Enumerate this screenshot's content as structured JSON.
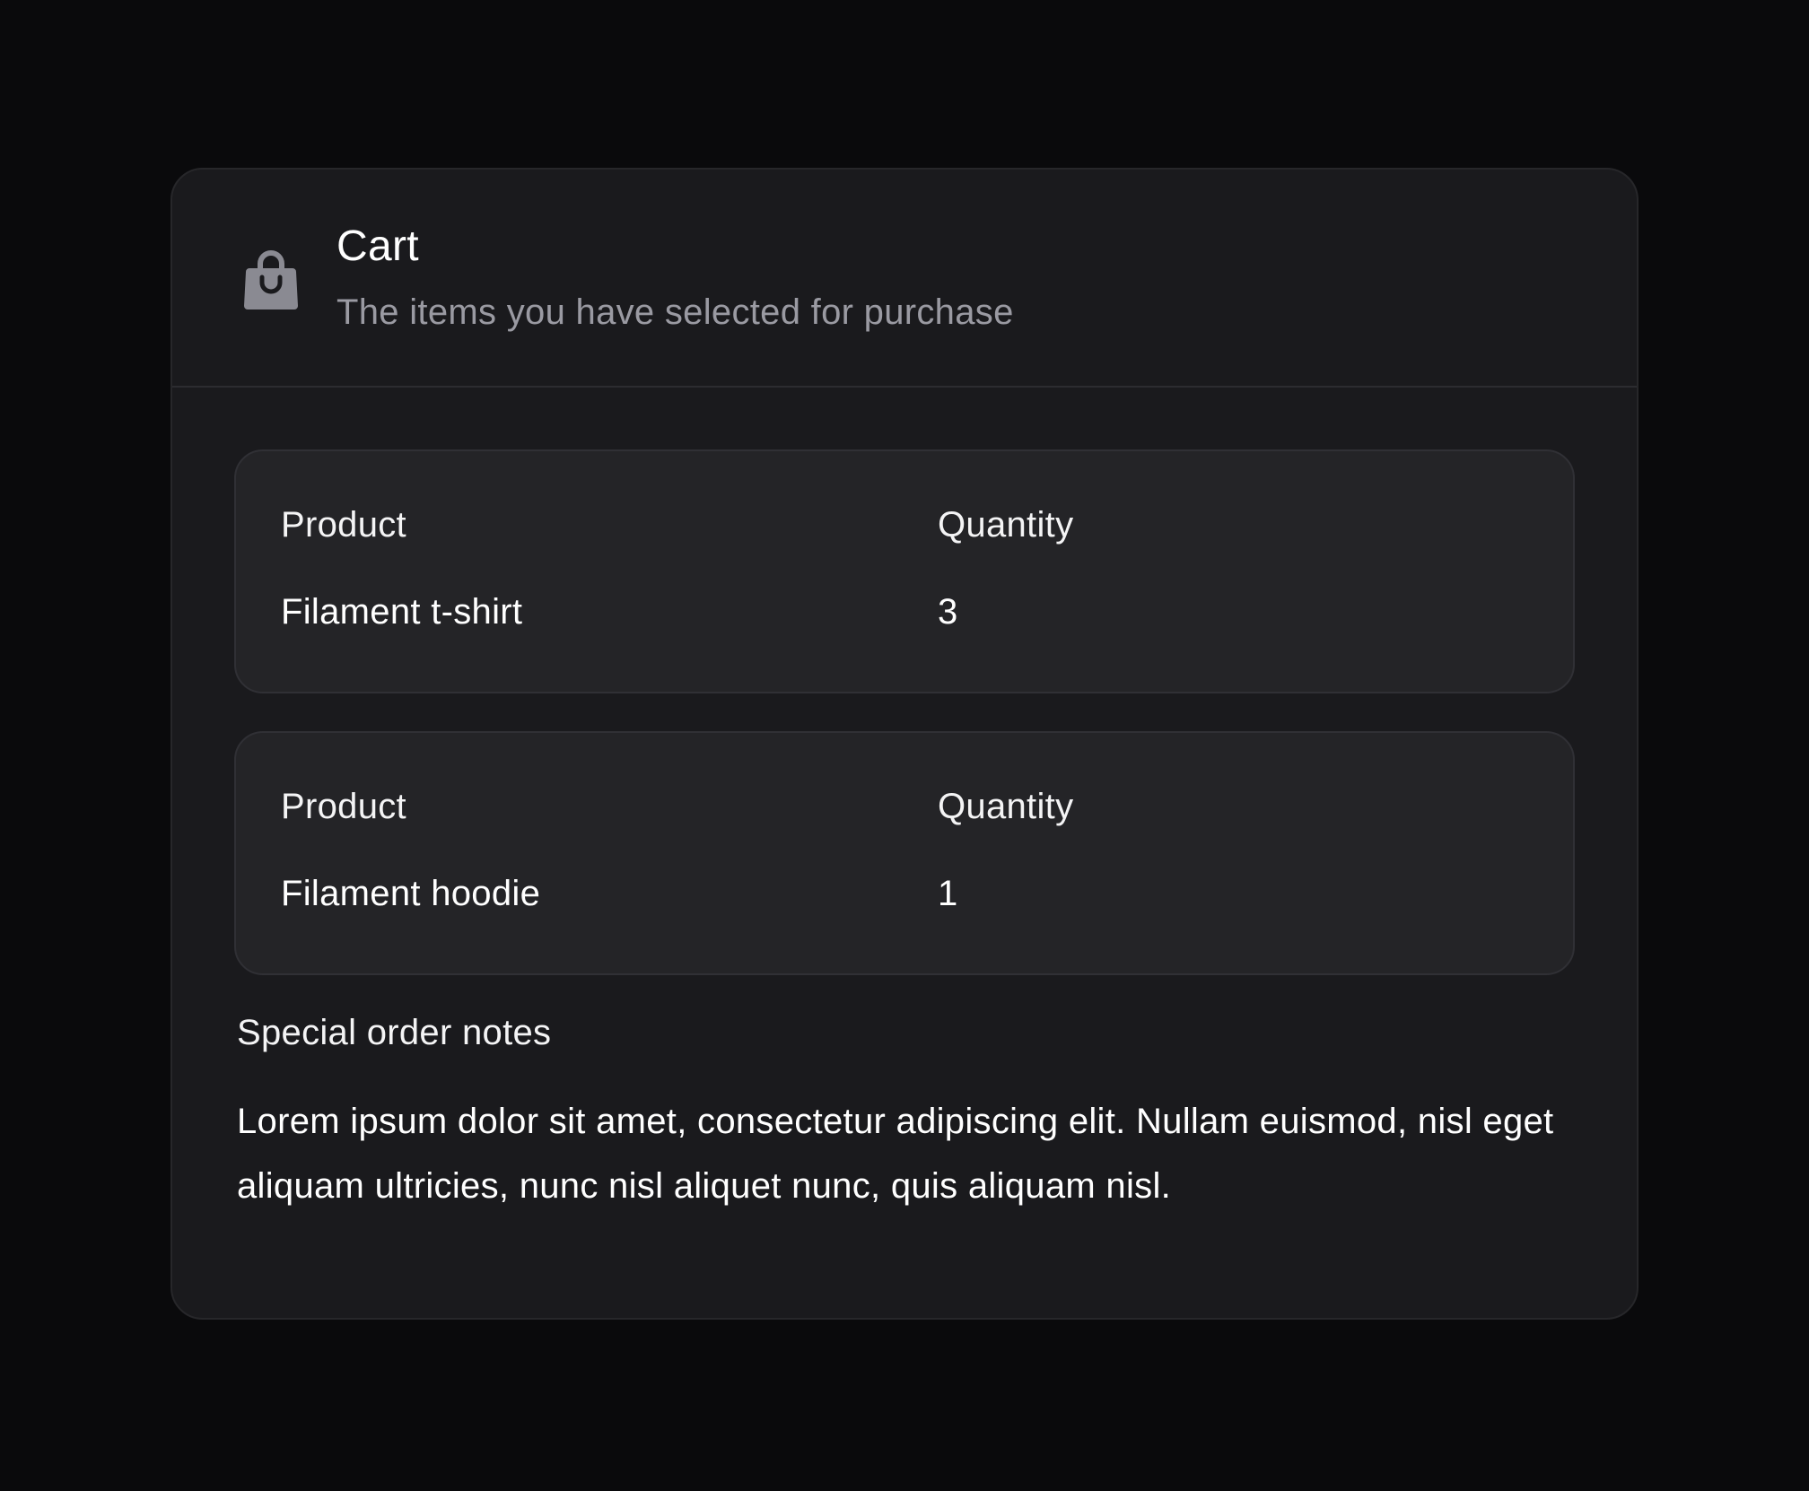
{
  "header": {
    "icon": "shopping-bag-icon",
    "title": "Cart",
    "subtitle": "The items you have selected for purchase"
  },
  "items": [
    {
      "product_label": "Product",
      "product_value": "Filament t-shirt",
      "quantity_label": "Quantity",
      "quantity_value": "3"
    },
    {
      "product_label": "Product",
      "product_value": "Filament hoodie",
      "quantity_label": "Quantity",
      "quantity_value": "1"
    }
  ],
  "notes": {
    "label": "Special order notes",
    "text": "Lorem ipsum dolor sit amet, consectetur adipiscing elit. Nullam euismod, nisl eget aliquam ultricies, nunc nisl aliquet nunc, quis aliquam nisl."
  },
  "colors": {
    "page_background": "#0a0a0c",
    "card_background": "#1a1a1d",
    "item_background": "#242427",
    "muted_text": "#9a9aa2",
    "icon_color": "#8a8a92"
  }
}
